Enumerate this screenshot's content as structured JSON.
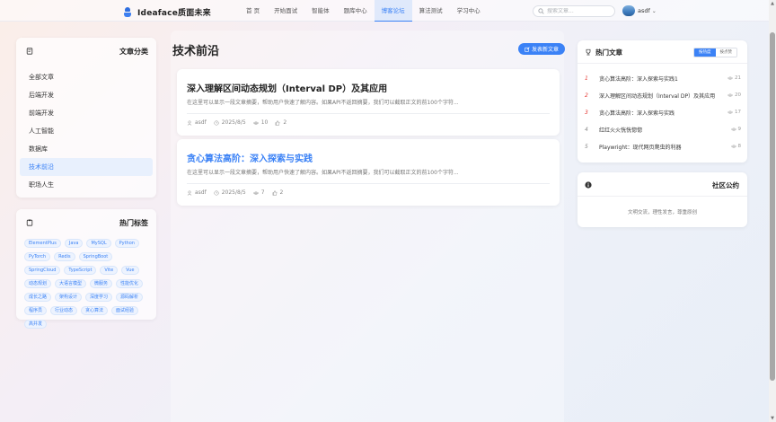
{
  "app": {
    "title": "Ideaface质面未来"
  },
  "nav": {
    "items": [
      {
        "label": "首 页",
        "active": false
      },
      {
        "label": "开始面试",
        "active": false
      },
      {
        "label": "智能体",
        "active": false
      },
      {
        "label": "题库中心",
        "active": false
      },
      {
        "label": "博客论坛",
        "active": true
      },
      {
        "label": "算法测试",
        "active": false
      },
      {
        "label": "学习中心",
        "active": false
      }
    ]
  },
  "search": {
    "placeholder": "搜索文章...",
    "value": ""
  },
  "user": {
    "name": "asdf"
  },
  "categories": {
    "title": "文章分类",
    "items": [
      {
        "label": "全部文章",
        "active": false
      },
      {
        "label": "后端开发",
        "active": false
      },
      {
        "label": "前端开发",
        "active": false
      },
      {
        "label": "人工智能",
        "active": false
      },
      {
        "label": "数据库",
        "active": false
      },
      {
        "label": "技术前沿",
        "active": true
      },
      {
        "label": "职场人生",
        "active": false
      }
    ]
  },
  "tags": {
    "title": "热门标签",
    "items": [
      "ElementPlus",
      "Java",
      "MySQL",
      "Python",
      "PyTorch",
      "Redis",
      "SpringBoot",
      "SpringCloud",
      "TypeScript",
      "Vite",
      "Vue",
      "动态规划",
      "大语言模型",
      "微服务",
      "性能优化",
      "成长之路",
      "架构设计",
      "深度学习",
      "源码解析",
      "程序员",
      "行业动态",
      "贪心算法",
      "面试经验",
      "高并发"
    ]
  },
  "main": {
    "title": "技术前沿",
    "post_button": "发表新文章",
    "articles": [
      {
        "title": "深入理解区间动态规划（Interval DP）及其应用",
        "summary": "在这里可以显示一段文章摘要，帮助用户快速了解内容。如果API不返回摘要，我们可以截取正文的前100个字符...",
        "author": "asdf",
        "date": "2025/8/5",
        "views": "10",
        "likes": "2"
      },
      {
        "title": "贪心算法高阶：深入探索与实践",
        "summary": "在这里可以显示一段文章摘要，帮助用户快速了解内容。如果API不返回摘要，我们可以截取正文的前100个字符...",
        "author": "asdf",
        "date": "2025/8/5",
        "views": "7",
        "likes": "2"
      }
    ]
  },
  "hot": {
    "title": "热门文章",
    "tabs": [
      {
        "label": "按热度",
        "active": true
      },
      {
        "label": "按点赞",
        "active": false
      }
    ],
    "items": [
      {
        "rank": "1",
        "title": "贪心算法高阶：深入探索与实践1",
        "views": "21"
      },
      {
        "rank": "2",
        "title": "深入理解区间动态规划（Interval DP）及其应用",
        "views": "20"
      },
      {
        "rank": "3",
        "title": "贪心算法高阶：深入探索与实践",
        "views": "17"
      },
      {
        "rank": "4",
        "title": "红红火火恍恍惚惚",
        "views": "9"
      },
      {
        "rank": "5",
        "title": "Playwright：现代网页爬虫的利器",
        "views": "8"
      }
    ]
  },
  "notice": {
    "title": "社区公约",
    "text": "文明交流，理性发言，尊重原创"
  },
  "colors": {
    "accent": "#3b82f6",
    "rank_hot": "#e53935"
  }
}
